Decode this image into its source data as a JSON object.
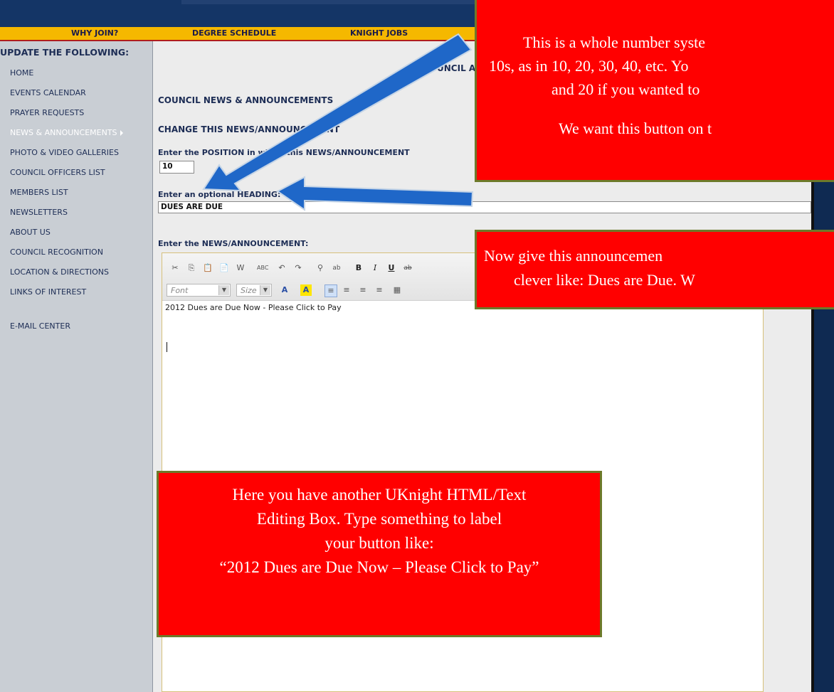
{
  "nav": {
    "items": [
      "WHY JOIN?",
      "DEGREE SCHEDULE",
      "KNIGHT JOBS"
    ]
  },
  "sidebar": {
    "heading": "UPDATE THE FOLLOWING:",
    "items": [
      "HOME",
      "EVENTS CALENDAR",
      "PRAYER REQUESTS",
      "NEWS & ANNOUNCEMENTS",
      "PHOTO & VIDEO GALLERIES",
      "COUNCIL OFFICERS LIST",
      "MEMBERS LIST",
      "NEWSLETTERS",
      "ABOUT US",
      "COUNCIL RECOGNITION",
      "LOCATION & DIRECTIONS",
      "LINKS OF INTEREST",
      "E-MAIL CENTER"
    ],
    "active_index": 3
  },
  "main": {
    "admin_title": "COUNCIL ADM",
    "section_title": "COUNCIL NEWS & ANNOUNCEMENTS",
    "change_title": "CHANGE THIS NEWS/ANNOUNCEMENT",
    "position_label": "Enter the POSITION in which this NEWS/ANNOUNCEMENT",
    "position_value": "10",
    "heading_label": "Enter an optional HEADING:",
    "heading_value": "DUES ARE DUE",
    "announcement_label": "Enter the NEWS/ANNOUNCEMENT:"
  },
  "editor": {
    "font_placeholder": "Font",
    "size_placeholder": "Size",
    "content": "2012 Dues are Due Now - Please Click to Pay",
    "toolbar_icons": [
      "cut-icon",
      "copy-icon",
      "paste-icon",
      "paste-text-icon",
      "paste-word-icon",
      "spellcheck-icon",
      "undo-icon",
      "redo-icon",
      "find-icon",
      "replace-icon",
      "bold-icon",
      "italic-icon",
      "underline-icon",
      "strike-icon"
    ]
  },
  "callouts": {
    "top_lines": [
      "This is a whole number syste",
      "10s, as in 10, 20, 30, 40, etc. Yo",
      "and 20 if you wanted to",
      "",
      "We want this button on t"
    ],
    "middle_lines": [
      "Now give this announcemen",
      "clever like: Dues are Due. W"
    ],
    "bottom_lines": [
      "Here you have another UKnight HTML/Text",
      "Editing Box. Type something to label",
      "your button like:",
      "“2012 Dues are Due Now – Please Click to Pay”"
    ]
  },
  "colors": {
    "callout": "#ff0000",
    "nav": "#f5b800",
    "arrow": "#1f67c8"
  }
}
